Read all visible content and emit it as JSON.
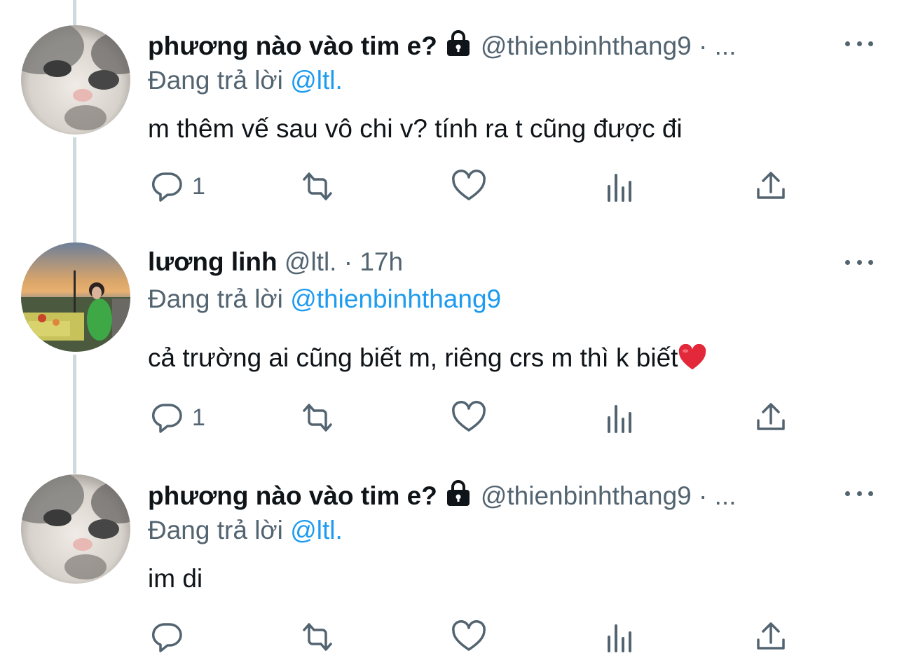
{
  "tweets": [
    {
      "name": "phương nào vào tim e?",
      "handle": "@thienbinhthang9",
      "meta": "· ...",
      "reply_prefix": "Đang trả lời",
      "reply_to": "@ltl.",
      "text": "m thêm vế sau vô chi v? tính ra t cũng được đi",
      "reply_count": "1",
      "avatar": "cat-avatar",
      "locked": true
    },
    {
      "name": "lương linh",
      "handle": "@ltl.",
      "meta": "· 17h",
      "reply_prefix": "Đang trả lời",
      "reply_to": "@thienbinhthang9",
      "text": "cả trường ai cũng biết m, riêng crs m thì k biết",
      "text_emoji": "red-heart-emoji",
      "reply_count": "1",
      "avatar": "sunset-picnic-avatar",
      "locked": false
    },
    {
      "name": "phương nào vào tim e?",
      "handle": "@thienbinhthang9",
      "meta": "· ...",
      "reply_prefix": "Đang trả lời",
      "reply_to": "@ltl.",
      "text": "im di",
      "reply_count": "",
      "avatar": "cat-avatar",
      "locked": true
    }
  ],
  "colors": {
    "primary_text": "#0f1419",
    "secondary_text": "#536471",
    "mention": "#1d9bf0",
    "thread_line": "#cfd9de"
  }
}
